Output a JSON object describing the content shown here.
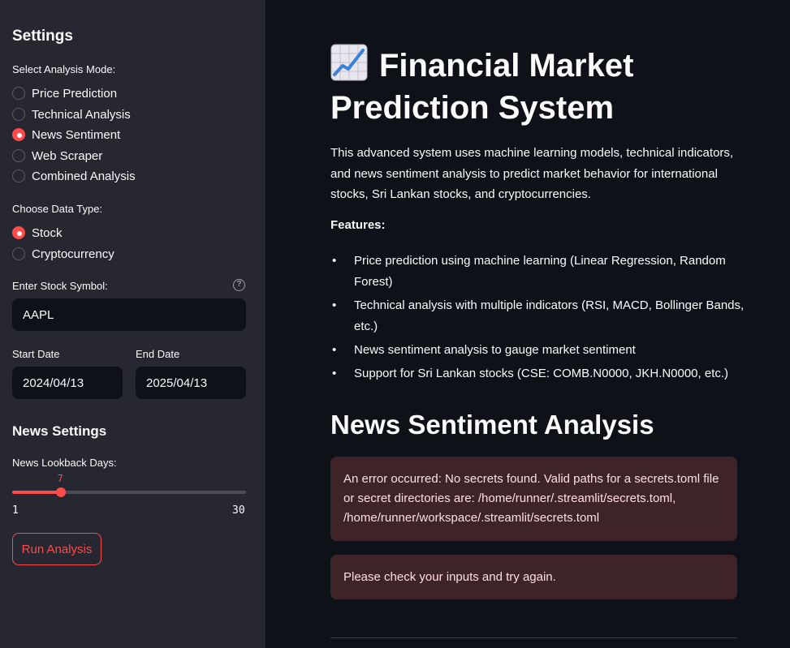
{
  "sidebar": {
    "title": "Settings",
    "analysis_mode": {
      "label": "Select Analysis Mode:",
      "options": [
        "Price Prediction",
        "Technical Analysis",
        "News Sentiment",
        "Web Scraper",
        "Combined Analysis"
      ],
      "selected": "News Sentiment"
    },
    "data_type": {
      "label": "Choose Data Type:",
      "options": [
        "Stock",
        "Cryptocurrency"
      ],
      "selected": "Stock"
    },
    "symbol": {
      "label": "Enter Stock Symbol:",
      "value": "AAPL",
      "help_icon": "help-circle-icon"
    },
    "start_date": {
      "label": "Start Date",
      "value": "2024/04/13"
    },
    "end_date": {
      "label": "End Date",
      "value": "2025/04/13"
    },
    "news_settings_title": "News Settings",
    "lookback": {
      "label": "News Lookback Days:",
      "value": 7,
      "value_text": "7",
      "min": 1,
      "min_text": "1",
      "max": 30,
      "max_text": "30"
    },
    "run_button": "Run Analysis"
  },
  "main": {
    "title_icon": "chart-increasing-icon",
    "title": "Financial Market Prediction System",
    "intro": "This advanced system uses machine learning models, technical indicators, and news sentiment analysis to predict market behavior for international stocks, Sri Lankan stocks, and cryptocurrencies.",
    "features_label": "Features:",
    "features": [
      "Price prediction using machine learning (Linear Regression, Random Forest)",
      "Technical analysis with multiple indicators (RSI, MACD, Bollinger Bands, etc.)",
      "News sentiment analysis to gauge market sentiment",
      "Support for Sri Lankan stocks (CSE: COMB.N0000, JKH.N0000, etc.)"
    ],
    "section_title": "News Sentiment Analysis",
    "errors": [
      "An error occurred: No secrets found. Valid paths for a secrets.toml file or secret directories are: /home/runner/.streamlit/secrets.toml, /home/runner/workspace/.streamlit/secrets.toml",
      "Please check your inputs and try again."
    ]
  },
  "colors": {
    "accent": "#ff4b4b",
    "sidebar_bg": "#262730",
    "main_bg": "#0e1117",
    "error_bg": "#3e2428"
  }
}
